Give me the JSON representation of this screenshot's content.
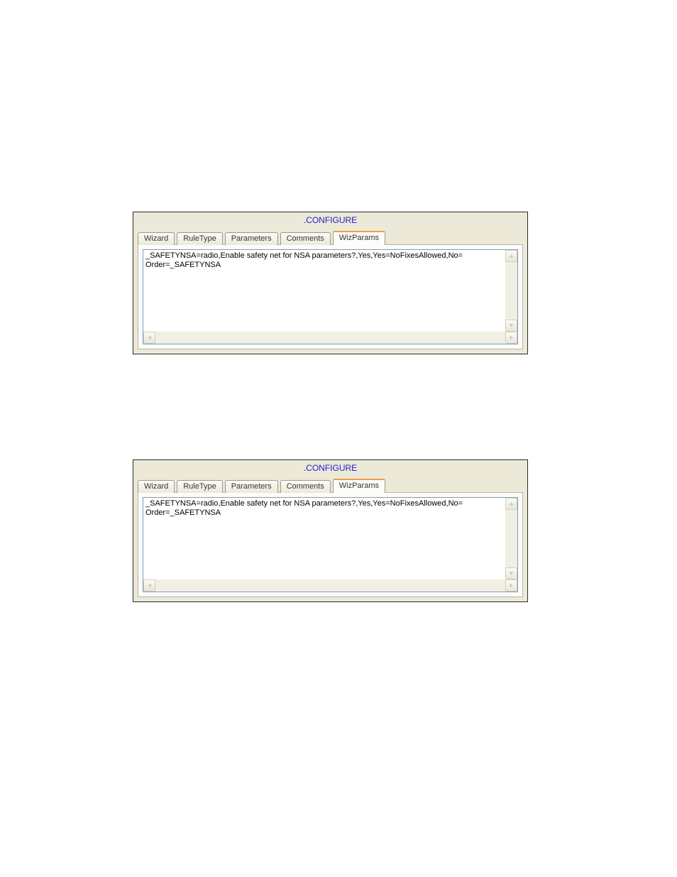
{
  "panels": [
    {
      "title": ".CONFIGURE",
      "tabs": [
        {
          "label": "Wizard",
          "active": false
        },
        {
          "label": "RuleType",
          "active": false
        },
        {
          "label": "Parameters",
          "active": false
        },
        {
          "label": "Comments",
          "active": false
        },
        {
          "label": "WizParams",
          "active": true
        }
      ],
      "content": "_SAFETYNSA=radio,Enable safety net for NSA parameters?,Yes,Yes=NoFixesAllowed,No=\nOrder=_SAFETYNSA"
    },
    {
      "title": ".CONFIGURE",
      "tabs": [
        {
          "label": "Wizard",
          "active": false
        },
        {
          "label": "RuleType",
          "active": false
        },
        {
          "label": "Parameters",
          "active": false
        },
        {
          "label": "Comments",
          "active": false
        },
        {
          "label": "WizParams",
          "active": true
        }
      ],
      "content": "_SAFETYNSA=radio,Enable safety net for NSA parameters?,Yes,Yes=NoFixesAllowed,No=\nOrder=_SAFETYNSA"
    }
  ]
}
